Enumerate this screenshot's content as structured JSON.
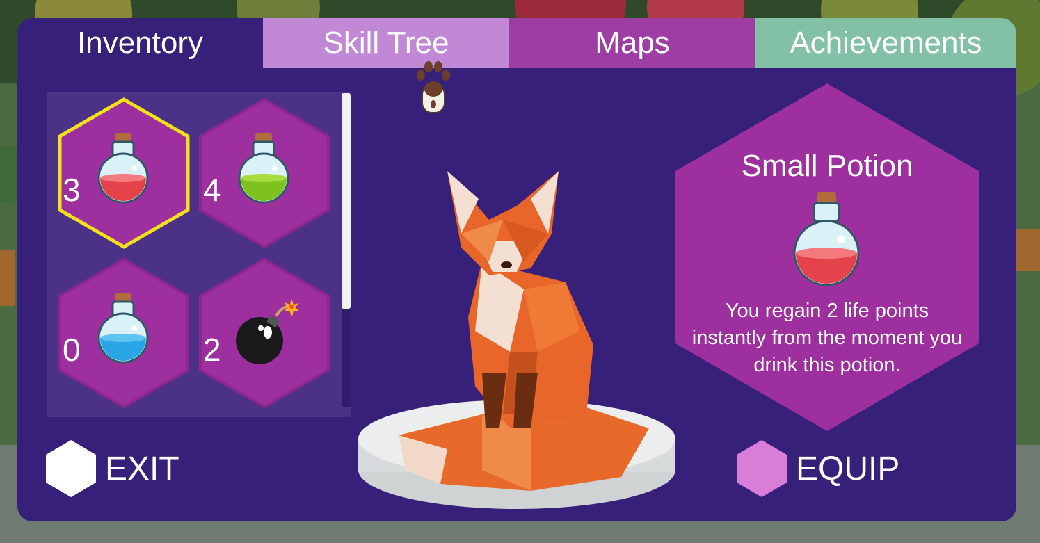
{
  "tabs": [
    {
      "label": "Inventory",
      "active": true
    },
    {
      "label": "Skill Tree"
    },
    {
      "label": "Maps"
    },
    {
      "label": "Achievements"
    }
  ],
  "inventory": {
    "slots": [
      {
        "count": "3",
        "icon": "red-potion-icon",
        "selected": true
      },
      {
        "count": "4",
        "icon": "green-potion-icon"
      },
      {
        "count": "0",
        "icon": "blue-potion-icon"
      },
      {
        "count": "2",
        "icon": "bomb-icon"
      }
    ]
  },
  "detail": {
    "title": "Small Potion",
    "icon": "red-potion-icon",
    "description": "You regain 2 life points instantly from the moment you drink this potion."
  },
  "actions": {
    "exit_label": "EXIT",
    "equip_label": "EQUIP"
  },
  "cursor_icon": "paw-cursor-icon",
  "character": "fox-model",
  "colors": {
    "panel": "#372079",
    "slot": "#9e2f9f",
    "selected_border": "#f4e11a",
    "tab_skill": "#c188d5",
    "tab_maps": "#9e3ea5",
    "tab_achievements": "#82c1a6",
    "equip_hex": "#d87ed9"
  }
}
